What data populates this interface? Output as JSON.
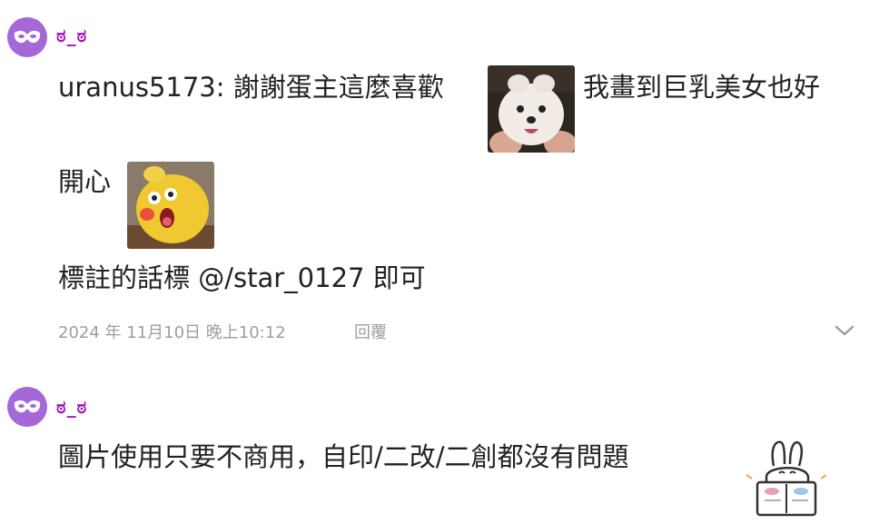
{
  "comments": [
    {
      "avatar_icon": "mask-avatar-icon",
      "username": "ಠ_ಠ",
      "lines": [
        "uranus5173: 謝謝蛋主這麼喜歡",
        "我畫到巨乳美女也好",
        "開心",
        "標註的話標 @/star_0127 即可"
      ],
      "stickers": [
        "white-puppy-sticker",
        "yellow-plush-sticker"
      ],
      "timestamp": "2024 年 11月10日 晚上10:12",
      "reply_label": "回覆",
      "expand_icon": "chevron-down-icon"
    },
    {
      "avatar_icon": "mask-avatar-icon",
      "username": "ಠ_ಠ",
      "lines": [
        "圖片使用只要不商用，自印/二改/二創都沒有問題"
      ],
      "stickers": [
        "bunny-reading-sticker"
      ]
    }
  ],
  "colors": {
    "avatar_bg": "#a568d8",
    "username": "#a018b8",
    "text": "#222222",
    "meta": "#9e9e9e"
  }
}
